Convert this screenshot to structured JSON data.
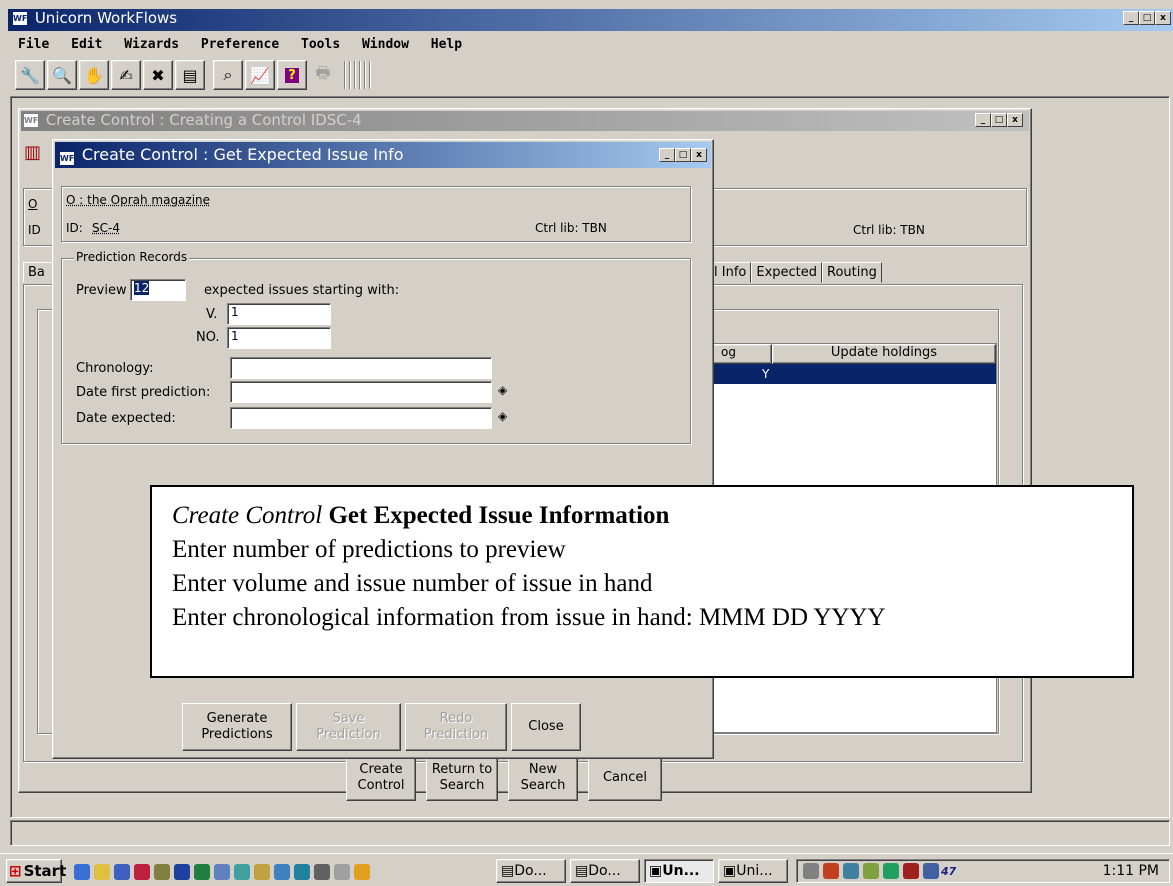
{
  "app": {
    "title": "Unicorn WorkFlows",
    "badge": "WF",
    "menu": [
      "File",
      "Edit",
      "Wizards",
      "Preference",
      "Tools",
      "Window",
      "Help"
    ]
  },
  "toolbar": {
    "icons": [
      "circulation-icon",
      "cataloging-icon",
      "acquisitions-icon",
      "serials-icon",
      "reports-icon",
      "utility-icon",
      "search-icon",
      "graph-icon",
      "help-icon",
      "print-icon"
    ]
  },
  "outer_window": {
    "title": "Create Control : Creating a Control IDSC-4",
    "header_title_partial": "O",
    "header_id_partial": "ID",
    "ctrl_lib": "Ctrl lib: TBN",
    "tab_partial": "Ba",
    "tabs": [
      "l Info",
      "Expected",
      "Routing"
    ],
    "table": {
      "col_partial": "og",
      "col_update": "Update holdings",
      "row_value": "Y"
    },
    "buttons": {
      "create_control": [
        "Create",
        "Control"
      ],
      "return_search": [
        "Return to",
        "Search"
      ],
      "new_search": [
        "New",
        "Search"
      ],
      "cancel": "Cancel"
    }
  },
  "dialog": {
    "title": "Create Control : Get Expected Issue Info",
    "record_title": "O : the Oprah magazine",
    "id_label": "ID:",
    "id_value": "SC-4",
    "ctrl_lib": "Ctrl lib: TBN",
    "group_label": "Prediction Records",
    "preview_label": "Preview",
    "preview_value": "12",
    "preview_suffix": "expected issues starting with:",
    "volume_label": "V.",
    "volume_value": "1",
    "number_label": "NO.",
    "number_value": "1",
    "chronology_label": "Chronology:",
    "chronology_value": "",
    "date_first_label": "Date first prediction:",
    "date_first_value": "",
    "date_expected_label": "Date expected:",
    "date_expected_value": "",
    "buttons": {
      "generate": [
        "Generate",
        "Predictions"
      ],
      "save": [
        "Save",
        "Prediction"
      ],
      "redo": [
        "Redo",
        "Prediction"
      ],
      "close": "Close"
    }
  },
  "callout": {
    "italic": "Create Control",
    "bold": "Get Expected Issue Information",
    "lines": [
      "Enter number of predictions to preview",
      "Enter volume and issue number of issue in hand",
      "Enter chronological information from issue in hand: MMM DD YYYY"
    ]
  },
  "taskbar": {
    "start": "Start",
    "tasks": [
      "Do...",
      "Do...",
      "Un...",
      "Uni..."
    ],
    "clock": "1:11 PM",
    "tray_text": "47"
  }
}
